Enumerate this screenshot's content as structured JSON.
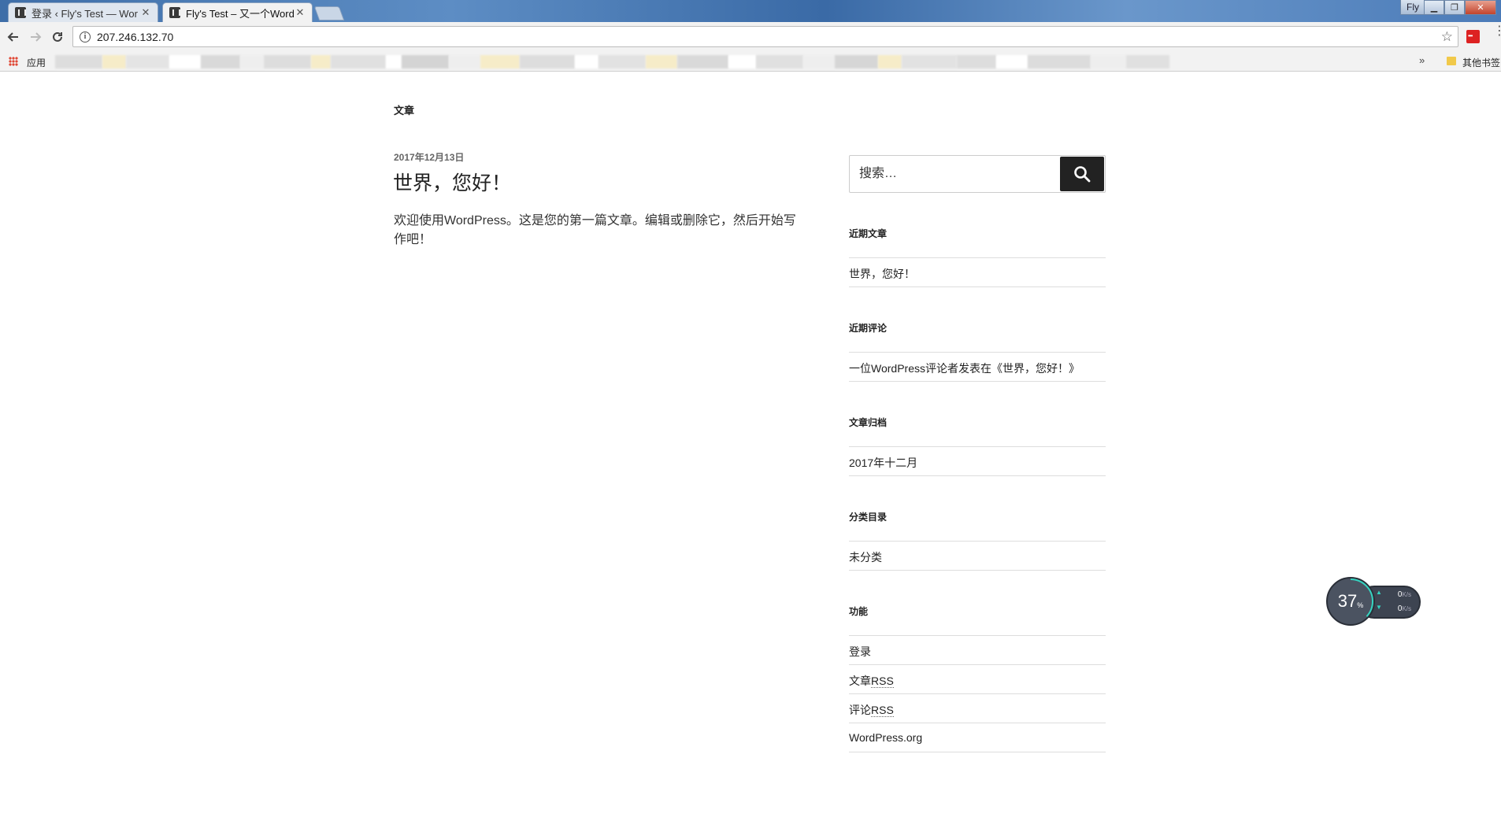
{
  "browser": {
    "tabs": [
      {
        "title": "登录 ‹ Fly's Test — Wor",
        "active": false
      },
      {
        "title": "Fly's Test – 又一个Word",
        "active": true
      }
    ],
    "user_badge": "Fly",
    "address": "207.246.132.70",
    "bookmarks": {
      "apps_label": "应用",
      "other_label": "其他书签",
      "more_glyph": "»"
    }
  },
  "page": {
    "heading": "文章",
    "post": {
      "date": "2017年12月13日",
      "title": "世界，您好！",
      "body": "欢迎使用WordPress。这是您的第一篇文章。编辑或删除它，然后开始写作吧！"
    },
    "search": {
      "placeholder": "搜索…"
    },
    "widgets": {
      "recent_posts": {
        "title": "近期文章",
        "items": [
          "世界，您好！"
        ]
      },
      "recent_comments": {
        "title": "近期评论",
        "items": [
          "一位WordPress评论者发表在《世界，您好！》"
        ]
      },
      "archives": {
        "title": "文章归档",
        "items": [
          "2017年十二月"
        ]
      },
      "categories": {
        "title": "分类目录",
        "items": [
          "未分类"
        ]
      },
      "meta": {
        "title": "功能",
        "items": [
          "登录",
          "文章",
          "RSS",
          "评论",
          "RSS",
          "WordPress.org"
        ]
      }
    }
  },
  "speed_widget": {
    "percent": "37",
    "percent_unit": "%",
    "upload": "0",
    "download": "0",
    "unit": "K/s"
  },
  "colors": {
    "accent_dark": "#222222",
    "search_button": "#222222",
    "speed_ring": "#35d3c0"
  }
}
